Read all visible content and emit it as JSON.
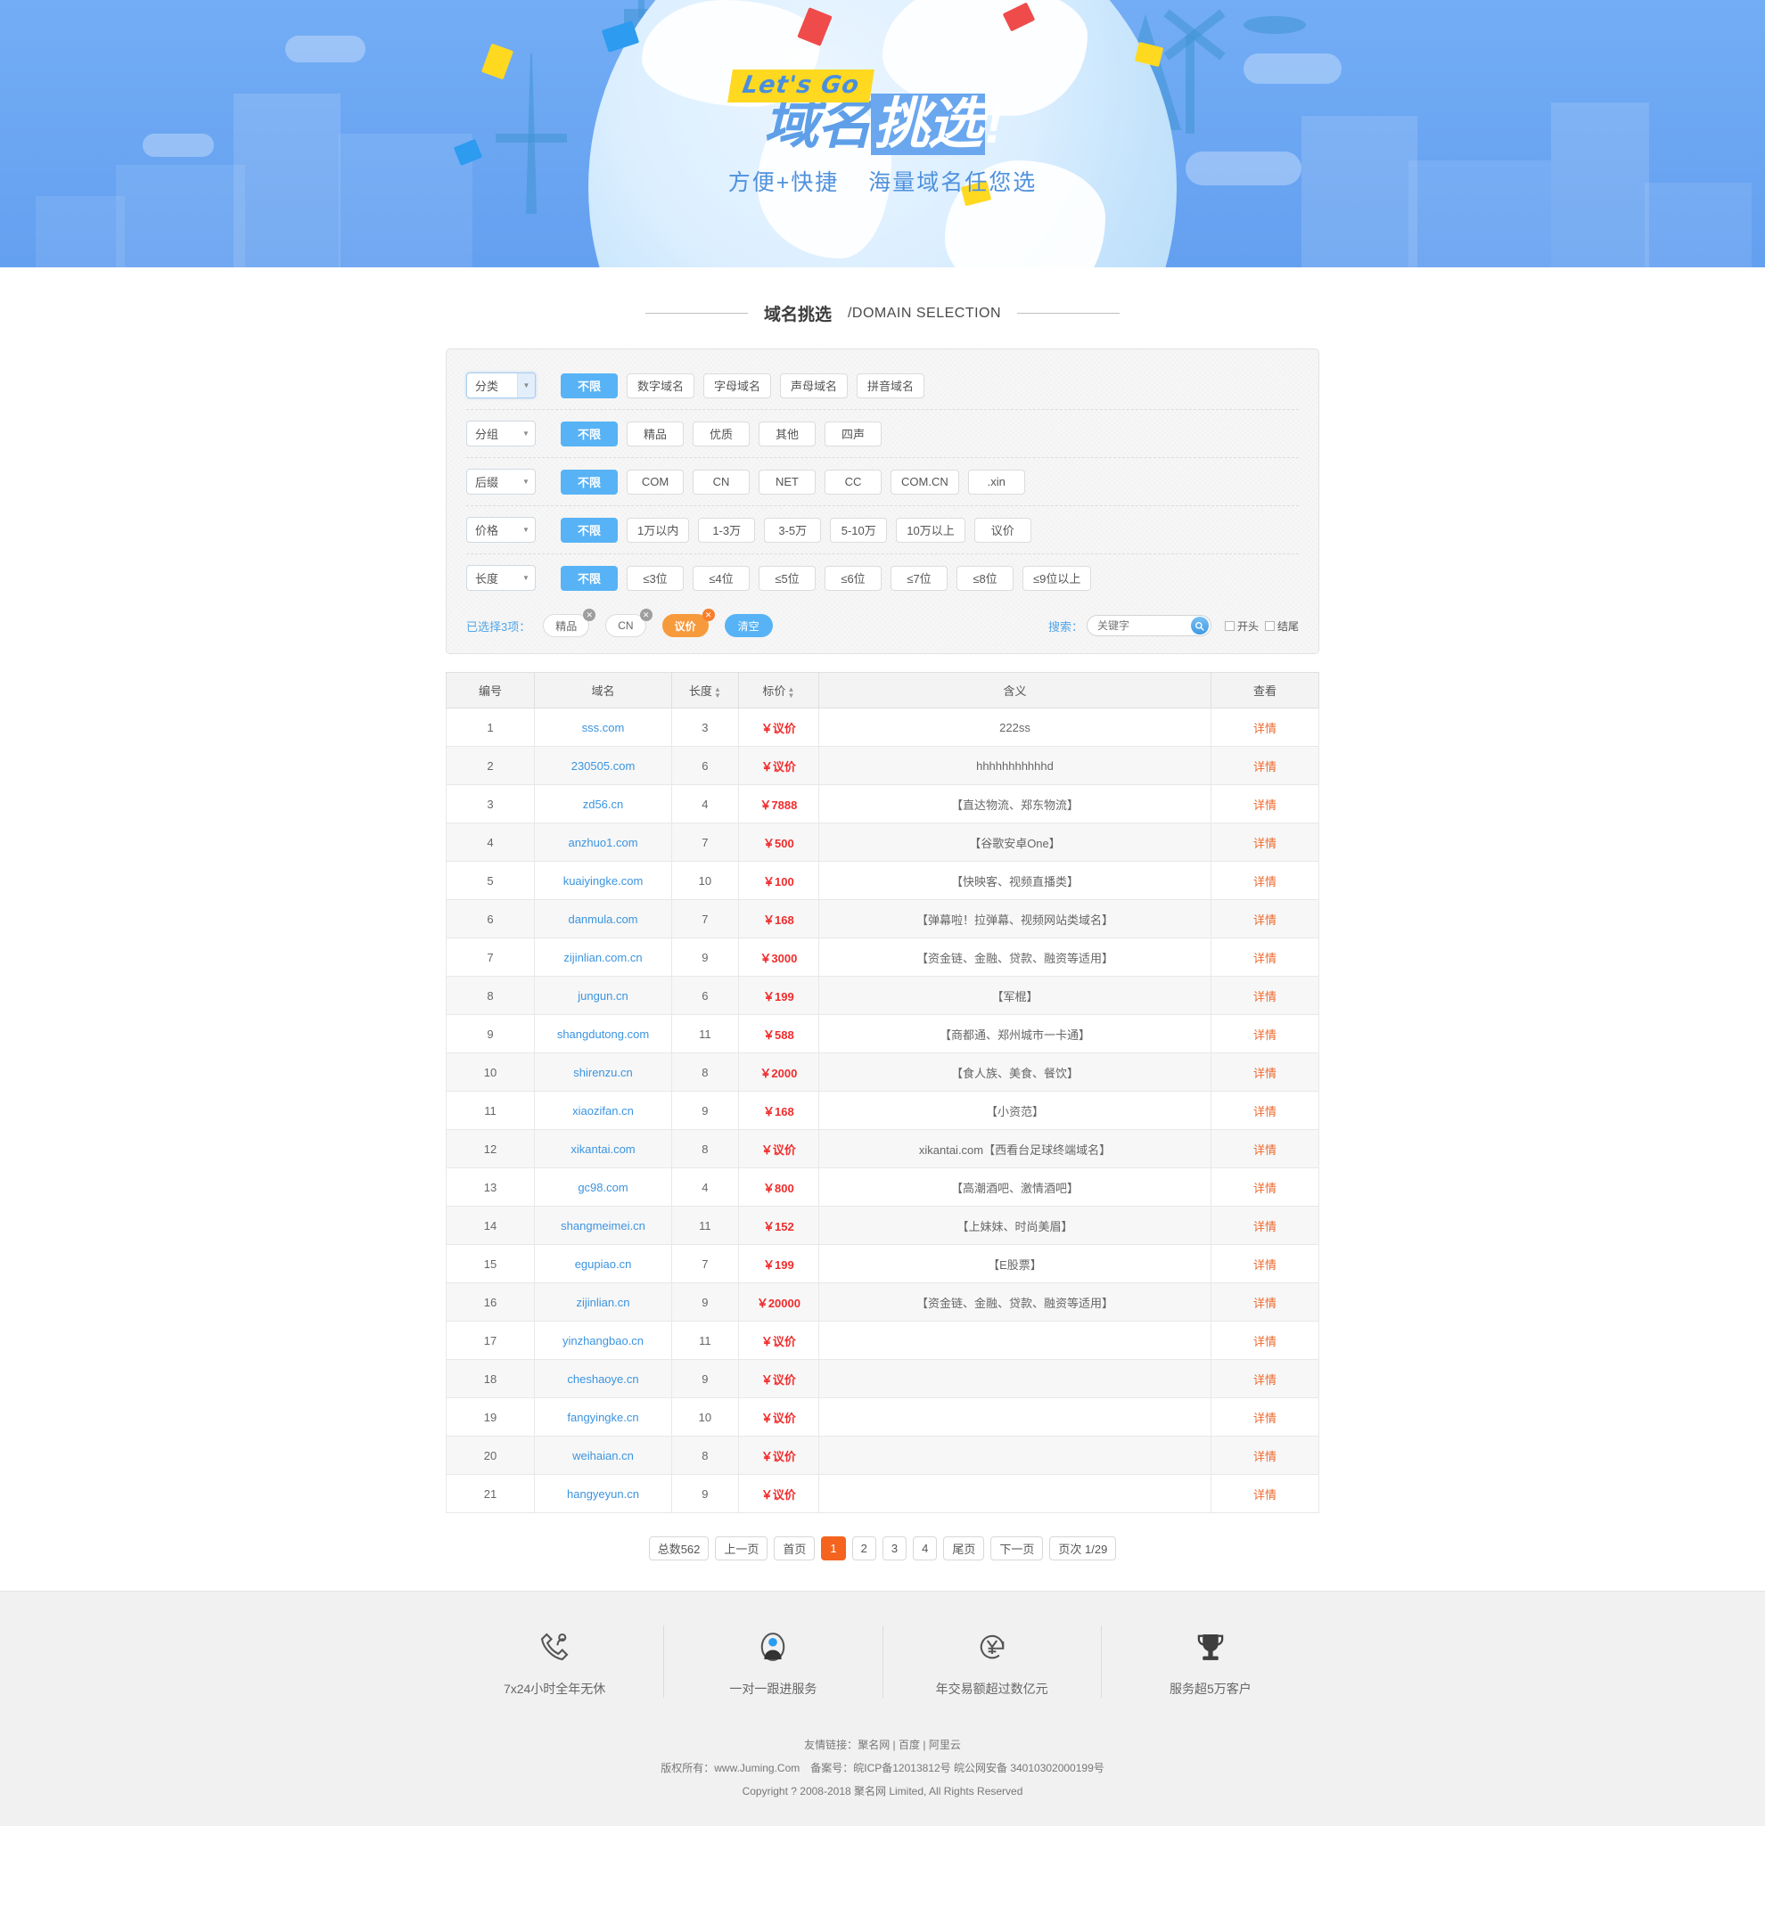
{
  "banner": {
    "badge": "Let's Go",
    "title_part1": "域名",
    "title_part2": "挑选",
    "title_bang": "!",
    "sub_left": "方便+快捷",
    "sub_right": "海量域名任您选"
  },
  "section": {
    "title_cn": "域名挑选",
    "title_en": "/DOMAIN SELECTION"
  },
  "filters": [
    {
      "label": "分类",
      "options": [
        "不限",
        "数字域名",
        "字母域名",
        "声母域名",
        "拼音域名"
      ],
      "active": 0
    },
    {
      "label": "分组",
      "options": [
        "不限",
        "精品",
        "优质",
        "其他",
        "四声"
      ],
      "active": 0
    },
    {
      "label": "后缀",
      "options": [
        "不限",
        "COM",
        "CN",
        "NET",
        "CC",
        "COM.CN",
        ".xin"
      ],
      "active": 0
    },
    {
      "label": "价格",
      "options": [
        "不限",
        "1万以内",
        "1-3万",
        "3-5万",
        "5-10万",
        "10万以上",
        "议价"
      ],
      "active": 0
    },
    {
      "label": "长度",
      "options": [
        "不限",
        "≤3位",
        "≤4位",
        "≤5位",
        "≤6位",
        "≤7位",
        "≤8位",
        "≤9位以上"
      ],
      "active": 0
    }
  ],
  "selected": {
    "label": "已选择3项：",
    "tags": [
      "精品",
      "CN",
      "议价"
    ],
    "highlight_tag": "议价",
    "clear_label": "清空",
    "close_glyph": "✕"
  },
  "search": {
    "label": "搜索：",
    "placeholder": "关键字",
    "value": "",
    "icon": "search-icon",
    "checkbox_start": "开头",
    "checkbox_end": "结尾"
  },
  "table": {
    "headers": [
      "编号",
      "域名",
      "长度",
      "标价",
      "含义",
      "查看"
    ],
    "sortable": [
      "长度",
      "标价"
    ],
    "view_label": "详情",
    "currency": "￥",
    "rows": [
      {
        "no": "1",
        "domain": "sss.com",
        "len": "3",
        "price": "议价",
        "meaning": "222ss"
      },
      {
        "no": "2",
        "domain": "230505.com",
        "len": "6",
        "price": "议价",
        "meaning": "hhhhhhhhhhhd"
      },
      {
        "no": "3",
        "domain": "zd56.cn",
        "len": "4",
        "price": "7888",
        "meaning": "【直达物流、郑东物流】"
      },
      {
        "no": "4",
        "domain": "anzhuo1.com",
        "len": "7",
        "price": "500",
        "meaning": "【谷歌安卓One】"
      },
      {
        "no": "5",
        "domain": "kuaiyingke.com",
        "len": "10",
        "price": "100",
        "meaning": "【快映客、视频直播类】"
      },
      {
        "no": "6",
        "domain": "danmula.com",
        "len": "7",
        "price": "168",
        "meaning": "【弹幕啦！拉弹幕、视频网站类域名】"
      },
      {
        "no": "7",
        "domain": "zijinlian.com.cn",
        "len": "9",
        "price": "3000",
        "meaning": "【资金链、金融、贷款、融资等适用】"
      },
      {
        "no": "8",
        "domain": "jungun.cn",
        "len": "6",
        "price": "199",
        "meaning": "【军棍】"
      },
      {
        "no": "9",
        "domain": "shangdutong.com",
        "len": "11",
        "price": "588",
        "meaning": "【商都通、郑州城市一卡通】"
      },
      {
        "no": "10",
        "domain": "shirenzu.cn",
        "len": "8",
        "price": "2000",
        "meaning": "【食人族、美食、餐饮】"
      },
      {
        "no": "11",
        "domain": "xiaozifan.cn",
        "len": "9",
        "price": "168",
        "meaning": "【小资范】"
      },
      {
        "no": "12",
        "domain": "xikantai.com",
        "len": "8",
        "price": "议价",
        "meaning": "xikantai.com【西看台足球终端域名】"
      },
      {
        "no": "13",
        "domain": "gc98.com",
        "len": "4",
        "price": "800",
        "meaning": "【高潮酒吧、激情酒吧】"
      },
      {
        "no": "14",
        "domain": "shangmeimei.cn",
        "len": "11",
        "price": "152",
        "meaning": "【上妹妹、时尚美眉】"
      },
      {
        "no": "15",
        "domain": "egupiao.cn",
        "len": "7",
        "price": "199",
        "meaning": "【E股票】"
      },
      {
        "no": "16",
        "domain": "zijinlian.cn",
        "len": "9",
        "price": "20000",
        "meaning": "【资金链、金融、贷款、融资等适用】"
      },
      {
        "no": "17",
        "domain": "yinzhangbao.cn",
        "len": "11",
        "price": "议价",
        "meaning": ""
      },
      {
        "no": "18",
        "domain": "cheshaoye.cn",
        "len": "9",
        "price": "议价",
        "meaning": ""
      },
      {
        "no": "19",
        "domain": "fangyingke.cn",
        "len": "10",
        "price": "议价",
        "meaning": ""
      },
      {
        "no": "20",
        "domain": "weihaian.cn",
        "len": "8",
        "price": "议价",
        "meaning": ""
      },
      {
        "no": "21",
        "domain": "hangyeyun.cn",
        "len": "9",
        "price": "议价",
        "meaning": ""
      }
    ]
  },
  "pagination": {
    "total": "总数562",
    "prev": "上一页",
    "first": "首页",
    "pages": [
      "1",
      "2",
      "3",
      "4"
    ],
    "active_page": "1",
    "last": "尾页",
    "next": "下一页",
    "page_info": "页次 1/29"
  },
  "features": [
    {
      "icon": "phone-support-icon",
      "text": "7x24小时全年无休"
    },
    {
      "icon": "agent-person-icon",
      "text": "一对一跟进服务"
    },
    {
      "icon": "yen-refresh-icon",
      "text": "年交易额超过数亿元"
    },
    {
      "icon": "trophy-icon",
      "text": "服务超5万客户"
    }
  ],
  "footer": {
    "links_label": "友情链接：",
    "links": [
      "聚名网",
      "百度",
      "阿里云"
    ],
    "copyright_line": "版权所有：www.Juming.Com　备案号：皖ICP备12013812号 皖公网安备 34010302000199号",
    "copyright_line2": "Copyright ? 2008-2018 聚名网 Limited, All Rights Reserved"
  },
  "colors": {
    "banner_blue": "#6fa9f2",
    "accent_blue": "#57b3f5",
    "accent_orange": "#f4641f",
    "price_red": "#f02c2c",
    "link_blue": "#3b94e0",
    "view_orange": "#ee6a2e",
    "badge_yellow": "#ffd920"
  }
}
